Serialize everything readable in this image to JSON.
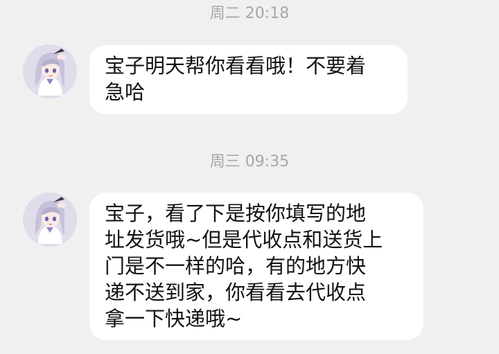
{
  "conversation": {
    "messages": [
      {
        "timestamp": "周二 20:18",
        "avatar_icon": "anime-girl-salute-avatar",
        "text": "宝子明天帮你看看哦！不要着\n急哈"
      },
      {
        "timestamp": "周三 09:35",
        "avatar_icon": "anime-girl-salute-avatar",
        "text": "宝子，看了下是按你填写的地\n址发货哦~但是代收点和送货上\n门是不一样的哈，有的地方快\n递不送到家，你看看去代收点\n拿一下快递哦~"
      }
    ]
  },
  "colors": {
    "background": "#f0f0f0",
    "bubble": "#ffffff",
    "timestamp": "#a6a6a6",
    "text": "#111111",
    "avatar_bg": "#e1dcea"
  }
}
